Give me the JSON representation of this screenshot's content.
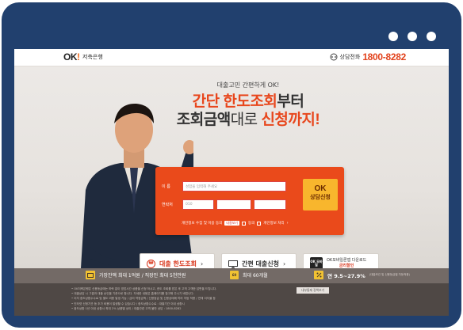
{
  "topbar": {
    "logo_text": "OK",
    "logo_excl": "!",
    "logo_sub": "저축은행",
    "phone_label": "상담전화",
    "phone_number": "1800-8282"
  },
  "hero": {
    "small_title": "대출고민 간편하게 OK!",
    "line1_accent": "간단 한도조회",
    "line1_rest": "부터",
    "line2_a": "조회금액",
    "line2_b": "대로 ",
    "line2_accent": "신청까지!"
  },
  "form": {
    "name_label": "이 름",
    "name_placeholder": "성함을 입력해 주세요",
    "phone_label": "연락처",
    "phone_prefix": "010",
    "submit_line1": "OK",
    "submit_line2": "상담신청",
    "consent_text": "개인정보 수집 및 이용 동의",
    "consent_view": "내용보기",
    "consent_agree": "동의",
    "consent_extra": "개인정보 처리"
  },
  "actions": {
    "limit_check": "대출 한도조회",
    "easy_apply": "간편 대출신청",
    "app_icon": "OK 모바일",
    "app_line1": "OK모바일론앱 다운로드",
    "app_line2": "금리할인"
  },
  "infobar": {
    "item1": "가망잔액 최대 1억원 / 직장인 최대 5천만원",
    "item2_icon": "60",
    "item2": "최대 60개월",
    "item3": "연 9.5~27.9%",
    "item3_note": "(대출조건 및 신용등급별 차등적용)"
  },
  "footer": {
    "button": "내부통제 정책보기",
    "lines": [
      "• OK저축은행은 신용등급에는 하락 없이 영업시간 상품을 신청 하시고, 한도 조회를 받은 후 고객 고객한 답변을 드립니다.",
      "• 대출상담 시 그결과 대출 승인을 기준으로 합니다. 자세한 내용은 홈페이지를 참고해 주시기 바랍니다.",
      "• 이자 중도상환수수료 및 별도 비용 발생 가능 / 금리 약정금액 / 신용등급 및 신용상태에 따라 차등 적용 / 연체 이자율 등",
      "• 인터넷 신청기관 등 추가 비용이 발생할 수 있습니다 / 중도상환수수료 : 대출기간 이내 상환시",
      "• 중도상환 1년 이내 상환시 최대 2% 상품별 상이 / 대출관련 고객 불만 상담 : 1800-8282"
    ]
  },
  "colors": {
    "frame": "#21406e",
    "accent": "#e8471d",
    "form_bg": "#ea4a1b",
    "button_yellow": "#f8b62d",
    "infobar_bg": "#736a66",
    "footer_bg": "#4f4845"
  }
}
